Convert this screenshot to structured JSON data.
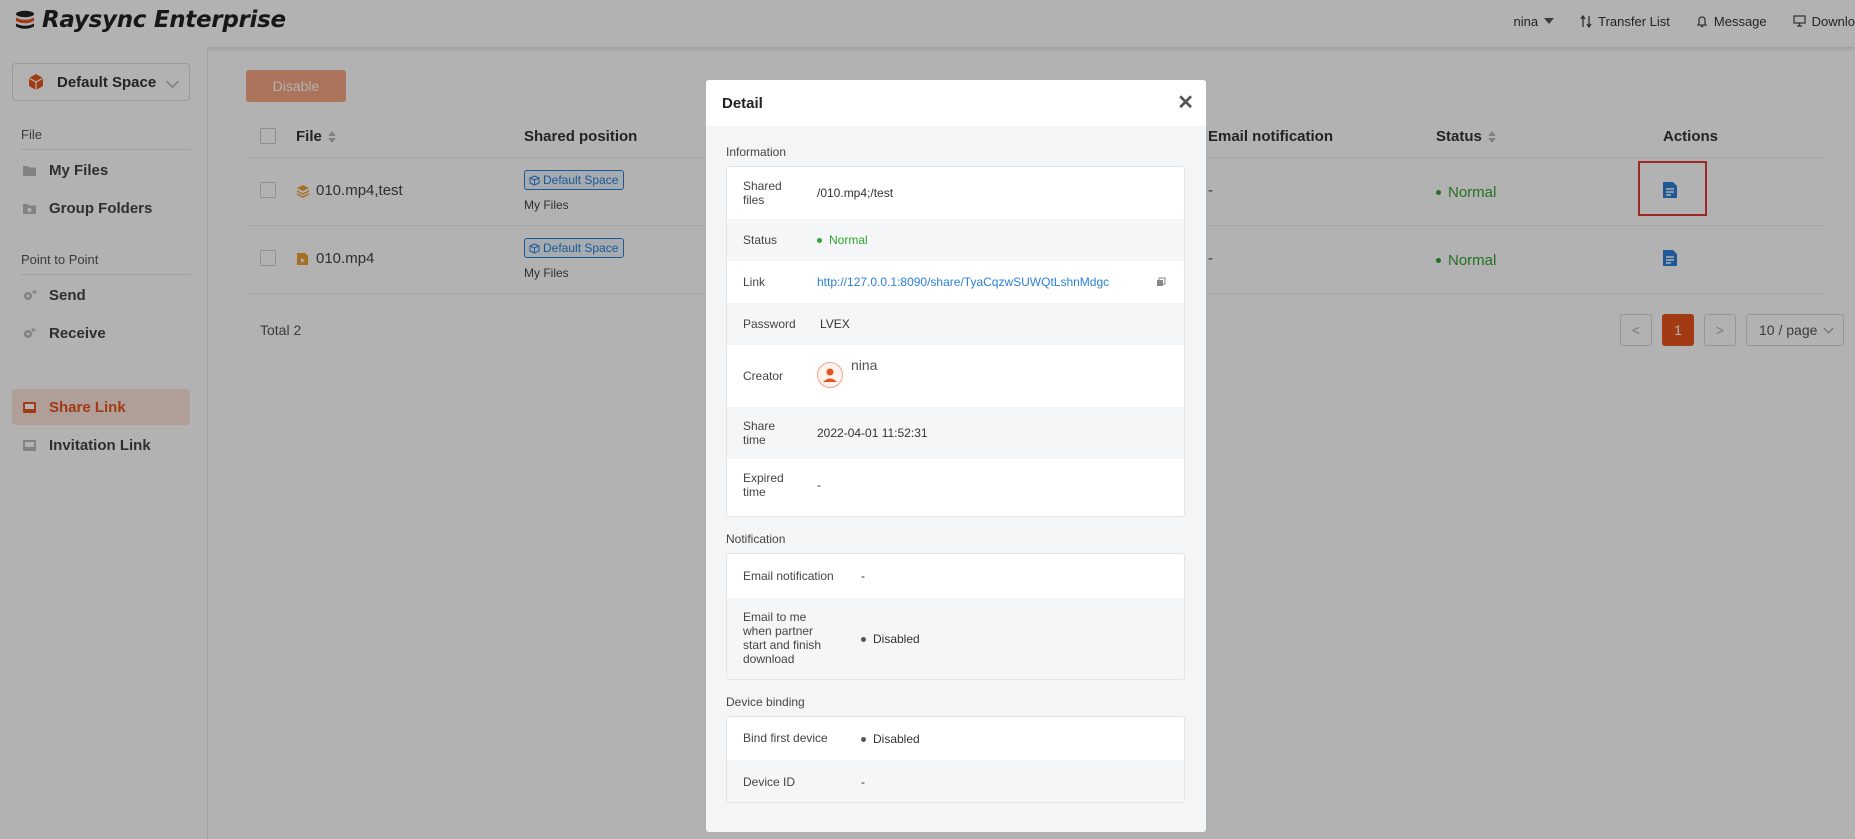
{
  "app": {
    "title": "Raysync Enterprise"
  },
  "header": {
    "user": "nina",
    "transfer_list": "Transfer List",
    "message": "Message",
    "download": "Downlo"
  },
  "sidebar": {
    "space_name": "Default Space",
    "section_file": "File",
    "my_files": "My Files",
    "group_folders": "Group Folders",
    "section_p2p": "Point to Point",
    "send": "Send",
    "receive": "Receive",
    "share_link": "Share Link",
    "invitation_link": "Invitation Link"
  },
  "toolbar": {
    "disable_label": "Disable"
  },
  "table": {
    "columns": {
      "file": "File",
      "shared_position": "Shared position",
      "email_notification": "Email notification",
      "status": "Status",
      "actions": "Actions"
    },
    "rows": [
      {
        "file": "010.mp4,test",
        "tag": "Default Space",
        "position": "My Files",
        "email": "-",
        "status": "Normal"
      },
      {
        "file": "010.mp4",
        "tag": "Default Space",
        "position": "My Files",
        "email": "-",
        "status": "Normal"
      }
    ]
  },
  "footer": {
    "total": "Total 2",
    "current_page": "1",
    "page_size": "10 / page",
    "prev": "<",
    "next": ">"
  },
  "modal": {
    "title": "Detail",
    "close": "✕",
    "information_title": "Information",
    "shared_files_label": "Shared files",
    "shared_files_value": "/010.mp4;/test",
    "status_label": "Status",
    "status_value": "Normal",
    "link_label": "Link",
    "link_value": "http://127.0.0.1:8090/share/TyaCqzwSUWQtLshnMdgc",
    "password_label": "Password",
    "password_value": "LVEX",
    "creator_label": "Creator",
    "creator_value": "nina",
    "share_time_label": "Share time",
    "share_time_value": "2022-04-01 11:52:31",
    "expired_time_label": "Expired time",
    "expired_time_value": "-",
    "notification_title": "Notification",
    "email_notification_label": "Email notification",
    "email_notification_value": "-",
    "email_to_me_label": "Email to me when partner start and finish download",
    "email_to_me_value": "Disabled",
    "device_binding_title": "Device binding",
    "bind_first_device_label": "Bind first device",
    "bind_first_device_value": "Disabled",
    "device_id_label": "Device ID",
    "device_id_value": "-"
  },
  "colors": {
    "accent": "#e8541e",
    "link": "#2b7fd8",
    "success": "#33a333",
    "highlight_box": "#e53935"
  }
}
